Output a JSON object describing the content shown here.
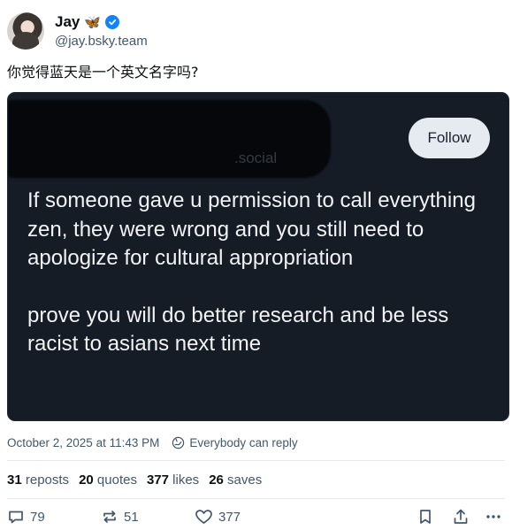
{
  "author": {
    "display_name": "Jay",
    "name_emoji": "🦋",
    "handle": "@jay.bsky.team",
    "verified": true,
    "verified_color": "#1083fe"
  },
  "post": {
    "text": "你觉得蓝天是一个英文名字吗?"
  },
  "embed": {
    "blurred_handle_fragment": ".social",
    "follow_label": "Follow",
    "paragraphs": [
      "If someone gave u permission to call everything zen, they were wrong and you still need to apologize for cultural appropriation",
      "prove you will do better research and be less racist to asians next time"
    ],
    "background": "#161c26"
  },
  "meta": {
    "timestamp": "October 2, 2025 at 11:43 PM",
    "reply_setting": "Everybody can reply"
  },
  "stats": {
    "reposts_count": "31",
    "reposts_label": "reposts",
    "quotes_count": "20",
    "quotes_label": "quotes",
    "likes_count": "377",
    "likes_label": "likes",
    "saves_count": "26",
    "saves_label": "saves"
  },
  "actions": {
    "reply_count": "79",
    "repost_count": "51",
    "like_count": "377",
    "icons": [
      "reply-icon",
      "repost-icon",
      "like-icon",
      "bookmark-icon",
      "share-icon",
      "more-icon"
    ]
  }
}
